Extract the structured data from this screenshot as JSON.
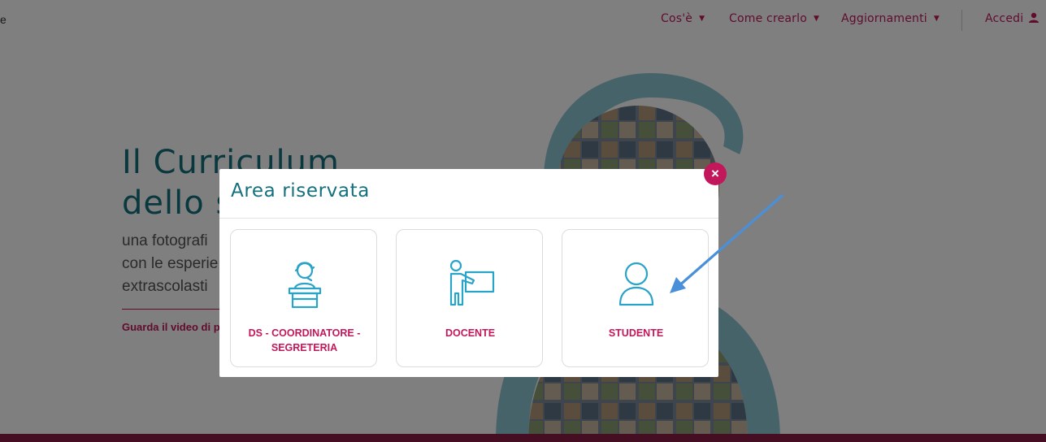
{
  "nav": {
    "left_fragment": "e",
    "items": [
      {
        "label": "Cos'è"
      },
      {
        "label": "Come crearlo"
      },
      {
        "label": "Aggiornamenti"
      }
    ],
    "login_label": "Accedi"
  },
  "hero": {
    "title": "Il Curriculum\ndello s",
    "subtitle": "una fotografi\ncon le esperie\nextrascolasti",
    "video_link": "Guarda il video di pr"
  },
  "modal": {
    "title": "Area riservata",
    "close_symbol": "×",
    "cards": [
      {
        "label": "DS - COORDINATORE - SEGRETERIA",
        "icon": "receptionist-icon"
      },
      {
        "label": "DOCENTE",
        "icon": "teacher-board-icon"
      },
      {
        "label": "STUDENTE",
        "icon": "student-user-icon"
      }
    ]
  },
  "colors": {
    "accent": "#c2185b",
    "teal": "#15707e",
    "icon": "#2aa3c8",
    "arrow": "#4a90d9"
  }
}
